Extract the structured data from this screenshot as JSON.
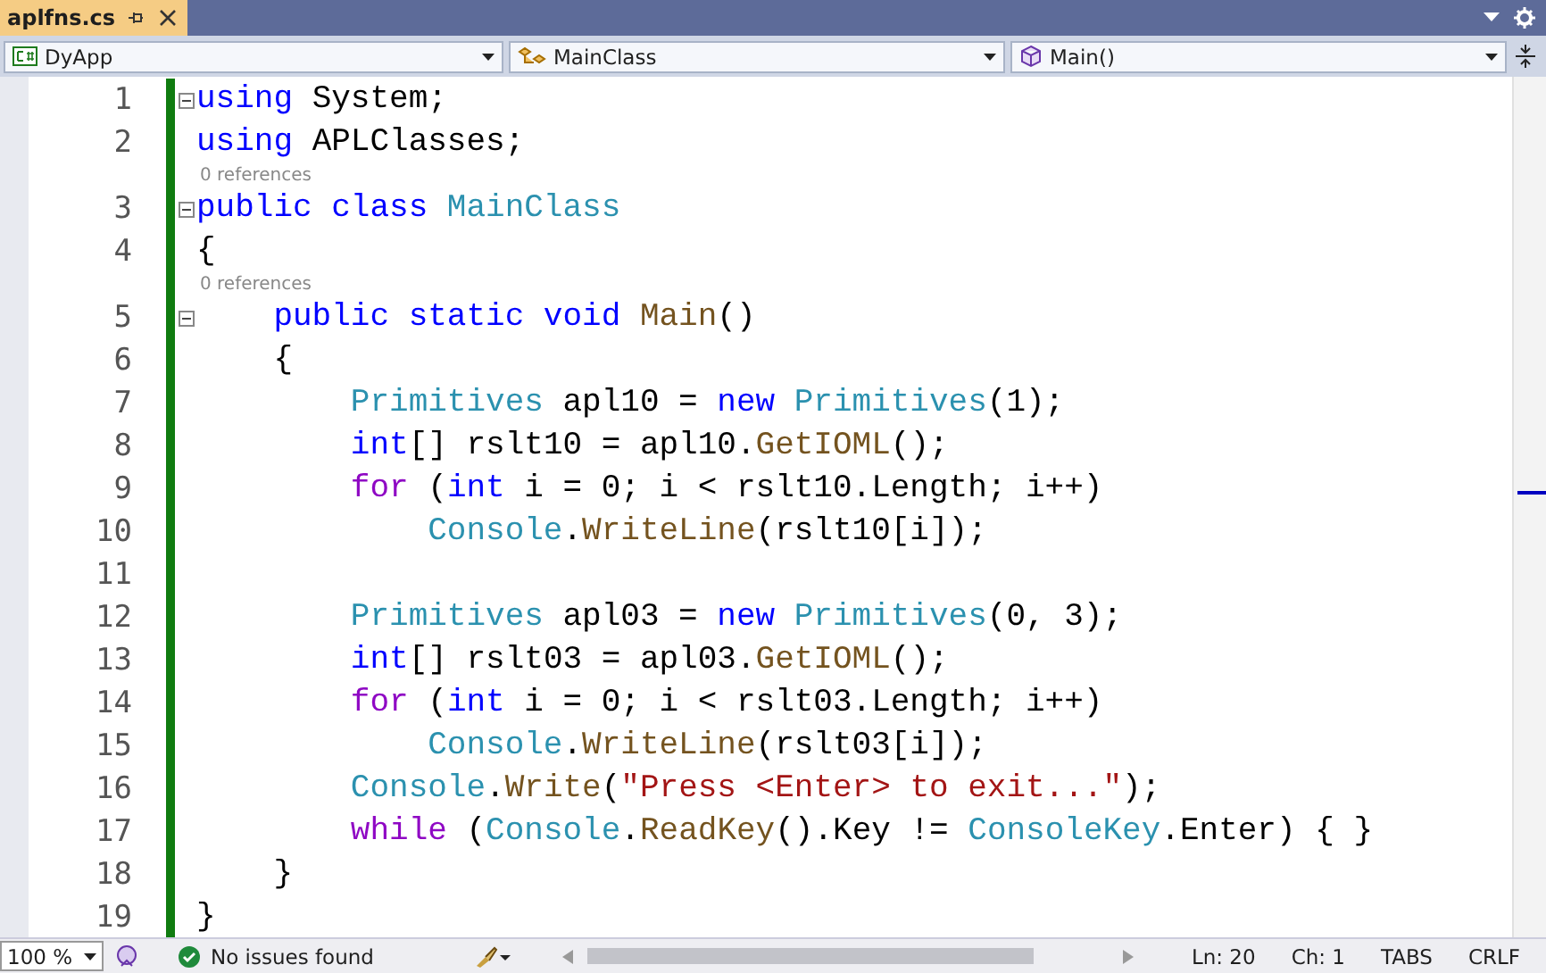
{
  "tabs": [
    {
      "label": "aplfns.cs",
      "selected": true
    }
  ],
  "nav_bar": {
    "project": "DyApp",
    "class": "MainClass",
    "member": "Main()"
  },
  "editor": {
    "lines": [
      {
        "number": "1",
        "expanded": true,
        "tokens": [
          {
            "text": "using",
            "kind": "keyword"
          },
          {
            "text": " System;",
            "kind": "plain"
          }
        ]
      },
      {
        "number": "2",
        "tokens": [
          {
            "text": "using",
            "kind": "keyword"
          },
          {
            "text": " APLClasses;",
            "kind": "plain"
          }
        ]
      },
      {
        "number": "3",
        "lens": "0 references",
        "expanded": true,
        "tokens": [
          {
            "text": "public class",
            "kind": "keyword"
          },
          {
            "text": " MainClass",
            "kind": "type"
          }
        ]
      },
      {
        "number": "4",
        "tokens": [
          {
            "text": "{",
            "kind": "plain"
          }
        ]
      },
      {
        "number": "5",
        "lens": "0 references",
        "expanded": true,
        "tokens": [
          {
            "text": "    public static void",
            "kind": "keyword"
          },
          {
            "text": " Main",
            "kind": "method"
          },
          {
            "text": "()",
            "kind": "plain"
          }
        ]
      },
      {
        "number": "6",
        "tokens": [
          {
            "text": "    {",
            "kind": "plain"
          }
        ]
      },
      {
        "number": "7",
        "tokens": [
          {
            "text": "        Primitives",
            "kind": "type"
          },
          {
            "text": " apl10 = ",
            "kind": "plain"
          },
          {
            "text": "new",
            "kind": "keyword"
          },
          {
            "text": " Primitives",
            "kind": "type"
          },
          {
            "text": "(1);",
            "kind": "plain"
          }
        ]
      },
      {
        "number": "8",
        "tokens": [
          {
            "text": "        int",
            "kind": "keyword"
          },
          {
            "text": "[] rslt10 = apl10.",
            "kind": "plain"
          },
          {
            "text": "GetIOML",
            "kind": "method"
          },
          {
            "text": "();",
            "kind": "plain"
          }
        ]
      },
      {
        "number": "9",
        "tokens": [
          {
            "text": "        for",
            "kind": "control"
          },
          {
            "text": " (",
            "kind": "plain"
          },
          {
            "text": "int",
            "kind": "keyword"
          },
          {
            "text": " i = 0; i < rslt10.Length; i++)",
            "kind": "plain"
          }
        ]
      },
      {
        "number": "10",
        "tokens": [
          {
            "text": "            Console",
            "kind": "type"
          },
          {
            "text": ".",
            "kind": "plain"
          },
          {
            "text": "WriteLine",
            "kind": "method"
          },
          {
            "text": "(rslt10[i]);",
            "kind": "plain"
          }
        ]
      },
      {
        "number": "11"
      },
      {
        "number": "12",
        "tokens": [
          {
            "text": "        Primitives",
            "kind": "type"
          },
          {
            "text": " apl03 = ",
            "kind": "plain"
          },
          {
            "text": "new",
            "kind": "keyword"
          },
          {
            "text": " Primitives",
            "kind": "type"
          },
          {
            "text": "(0, 3);",
            "kind": "plain"
          }
        ]
      },
      {
        "number": "13",
        "tokens": [
          {
            "text": "        int",
            "kind": "keyword"
          },
          {
            "text": "[] rslt03 = apl03.",
            "kind": "plain"
          },
          {
            "text": "GetIOML",
            "kind": "method"
          },
          {
            "text": "();",
            "kind": "plain"
          }
        ]
      },
      {
        "number": "14",
        "tokens": [
          {
            "text": "        for",
            "kind": "control"
          },
          {
            "text": " (",
            "kind": "plain"
          },
          {
            "text": "int",
            "kind": "keyword"
          },
          {
            "text": " i = 0; i < rslt03.Length; i++)",
            "kind": "plain"
          }
        ]
      },
      {
        "number": "15",
        "tokens": [
          {
            "text": "            Console",
            "kind": "type"
          },
          {
            "text": ".",
            "kind": "plain"
          },
          {
            "text": "WriteLine",
            "kind": "method"
          },
          {
            "text": "(rslt03[i]);",
            "kind": "plain"
          }
        ]
      },
      {
        "number": "16",
        "tokens": [
          {
            "text": "        Console",
            "kind": "type"
          },
          {
            "text": ".",
            "kind": "plain"
          },
          {
            "text": "Write",
            "kind": "method"
          },
          {
            "text": "(",
            "kind": "plain"
          },
          {
            "text": "\"Press <Enter> to exit...\"",
            "kind": "string"
          },
          {
            "text": ");",
            "kind": "plain"
          }
        ]
      },
      {
        "number": "17",
        "tokens": [
          {
            "text": "        while",
            "kind": "control"
          },
          {
            "text": " (",
            "kind": "plain"
          },
          {
            "text": "Console",
            "kind": "type"
          },
          {
            "text": ".",
            "kind": "plain"
          },
          {
            "text": "ReadKey",
            "kind": "method"
          },
          {
            "text": "().Key != ",
            "kind": "plain"
          },
          {
            "text": "ConsoleKey",
            "kind": "type"
          },
          {
            "text": ".Enter) { }",
            "kind": "plain"
          }
        ]
      },
      {
        "number": "18",
        "tokens": [
          {
            "text": "    }",
            "kind": "plain"
          }
        ]
      },
      {
        "number": "19",
        "tokens": [
          {
            "text": "}",
            "kind": "plain"
          }
        ]
      }
    ]
  },
  "status_bar": {
    "zoom": "100 %",
    "issues": "No issues found",
    "line": "Ln: 20",
    "column": "Ch: 1",
    "indent": "TABS",
    "line_ending": "CRLF"
  }
}
